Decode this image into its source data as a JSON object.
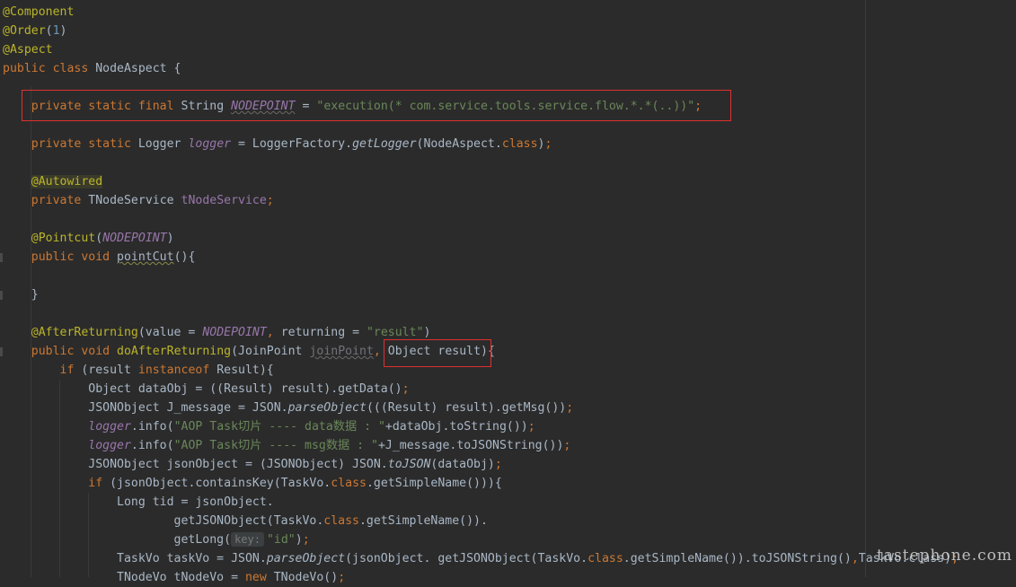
{
  "editor": {
    "theme_colors": {
      "background": "#2b2b2b",
      "annotation": "#bbb529",
      "keyword": "#cc7832",
      "string": "#6a8759",
      "number": "#6897bb",
      "field": "#9876aa",
      "plain": "#a9b7c6",
      "highlight_box": "#e03030"
    },
    "lines": [
      [
        [
          "ann",
          "@Component"
        ]
      ],
      [
        [
          "ann",
          "@Order"
        ],
        [
          "plain",
          "("
        ],
        [
          "num",
          "1"
        ],
        [
          "plain",
          ")"
        ]
      ],
      [
        [
          "ann",
          "@Aspect"
        ]
      ],
      [
        [
          "kw",
          "public class "
        ],
        [
          "plain",
          "NodeAspect {"
        ]
      ],
      [],
      [
        [
          "plain",
          "    "
        ],
        [
          "kw",
          "private static final "
        ],
        [
          "plain",
          "String "
        ],
        [
          "field it squig",
          "NODEPOINT"
        ],
        [
          "plain",
          " = "
        ],
        [
          "str",
          "\"execution(* com.service.tools.service.flow.*.*(..))\""
        ],
        [
          "kw",
          ";"
        ]
      ],
      [],
      [
        [
          "plain",
          "    "
        ],
        [
          "kw",
          "private static "
        ],
        [
          "plain",
          "Logger "
        ],
        [
          "field it",
          "logger"
        ],
        [
          "plain",
          " = LoggerFactory."
        ],
        [
          "it",
          "getLogger"
        ],
        [
          "plain",
          "(NodeAspect."
        ],
        [
          "kw",
          "class"
        ],
        [
          "plain",
          ")"
        ],
        [
          "kw",
          ";"
        ]
      ],
      [],
      [
        [
          "plain",
          "    "
        ],
        [
          "hl-autowired",
          "@Autowired"
        ]
      ],
      [
        [
          "plain",
          "    "
        ],
        [
          "kw",
          "private "
        ],
        [
          "plain",
          "TNodeService "
        ],
        [
          "field",
          "tNodeService"
        ],
        [
          "kw",
          ";"
        ]
      ],
      [],
      [
        [
          "plain",
          "    "
        ],
        [
          "ann",
          "@Pointcut"
        ],
        [
          "plain",
          "("
        ],
        [
          "field it",
          "NODEPOINT"
        ],
        [
          "plain",
          ")"
        ]
      ],
      [
        [
          "plain",
          "    "
        ],
        [
          "kw",
          "public void "
        ],
        [
          "squig-y",
          "pointCut"
        ],
        [
          "plain",
          "(){"
        ]
      ],
      [],
      [
        [
          "plain",
          "    }"
        ]
      ],
      [],
      [
        [
          "plain",
          "    "
        ],
        [
          "ann",
          "@AfterReturning"
        ],
        [
          "plain",
          "(value = "
        ],
        [
          "field it",
          "NODEPOINT"
        ],
        [
          "kw",
          ", "
        ],
        [
          "plain",
          "returning = "
        ],
        [
          "str",
          "\"result\""
        ],
        [
          "plain",
          ")"
        ]
      ],
      [
        [
          "plain",
          "    "
        ],
        [
          "kw",
          "public void "
        ],
        [
          "ann",
          "doAfterReturning"
        ],
        [
          "plain",
          "(JoinPoint "
        ],
        [
          "unused squig",
          "joinPoint"
        ],
        [
          "kw",
          ", "
        ],
        [
          "plain",
          "Object result){"
        ]
      ],
      [
        [
          "plain",
          "        "
        ],
        [
          "kw",
          "if "
        ],
        [
          "plain",
          "(result "
        ],
        [
          "kw",
          "instanceof "
        ],
        [
          "plain",
          "Result){"
        ]
      ],
      [
        [
          "plain",
          "            Object dataObj = ((Result) result).getData()"
        ],
        [
          "kw",
          ";"
        ]
      ],
      [
        [
          "plain",
          "            JSONObject J_message = JSON."
        ],
        [
          "it",
          "parseObject"
        ],
        [
          "plain",
          "(((Result) result).getMsg())"
        ],
        [
          "kw",
          ";"
        ]
      ],
      [
        [
          "plain",
          "            "
        ],
        [
          "field it",
          "logger"
        ],
        [
          "plain",
          ".info("
        ],
        [
          "str",
          "\"AOP Task切片 ---- data数据 : \""
        ],
        [
          "plain",
          "+dataObj.toString())"
        ],
        [
          "kw",
          ";"
        ]
      ],
      [
        [
          "plain",
          "            "
        ],
        [
          "field it",
          "logger"
        ],
        [
          "plain",
          ".info("
        ],
        [
          "str",
          "\"AOP Task切片 ---- msg数据 : \""
        ],
        [
          "plain",
          "+J_message.toJSONString())"
        ],
        [
          "kw",
          ";"
        ]
      ],
      [
        [
          "plain",
          "            JSONObject jsonObject = (JSONObject) JSON."
        ],
        [
          "it",
          "toJSON"
        ],
        [
          "plain",
          "(dataObj)"
        ],
        [
          "kw",
          ";"
        ]
      ],
      [
        [
          "plain",
          "            "
        ],
        [
          "kw",
          "if "
        ],
        [
          "plain",
          "(jsonObject.containsKey(TaskVo."
        ],
        [
          "kw",
          "class"
        ],
        [
          "plain",
          ".getSimpleName())){"
        ]
      ],
      [
        [
          "plain",
          "                Long tid = jsonObject."
        ]
      ],
      [
        [
          "plain",
          "                        getJSONObject(TaskVo."
        ],
        [
          "kw",
          "class"
        ],
        [
          "plain",
          ".getSimpleName())."
        ]
      ],
      [
        [
          "plain",
          "                        getLong("
        ],
        [
          "hint",
          "key:"
        ],
        [
          "str",
          "\"id\""
        ],
        [
          "plain",
          ")"
        ],
        [
          "kw",
          ";"
        ]
      ],
      [
        [
          "plain",
          "                TaskVo taskVo = JSON."
        ],
        [
          "it",
          "parseObject"
        ],
        [
          "plain",
          "(jsonObject. getJSONObject(TaskVo."
        ],
        [
          "kw",
          "class"
        ],
        [
          "plain",
          ".getSimpleName()).toJSONString()"
        ],
        [
          "kw",
          ","
        ],
        [
          "plain",
          "TaskVo.class)"
        ],
        [
          "kw",
          ";"
        ]
      ],
      [
        [
          "plain",
          "                TNodeVo tNodeVo = "
        ],
        [
          "kw",
          "new "
        ],
        [
          "plain",
          "TNodeVo()"
        ],
        [
          "kw",
          ";"
        ]
      ]
    ]
  },
  "watermark": "tastephone.com"
}
